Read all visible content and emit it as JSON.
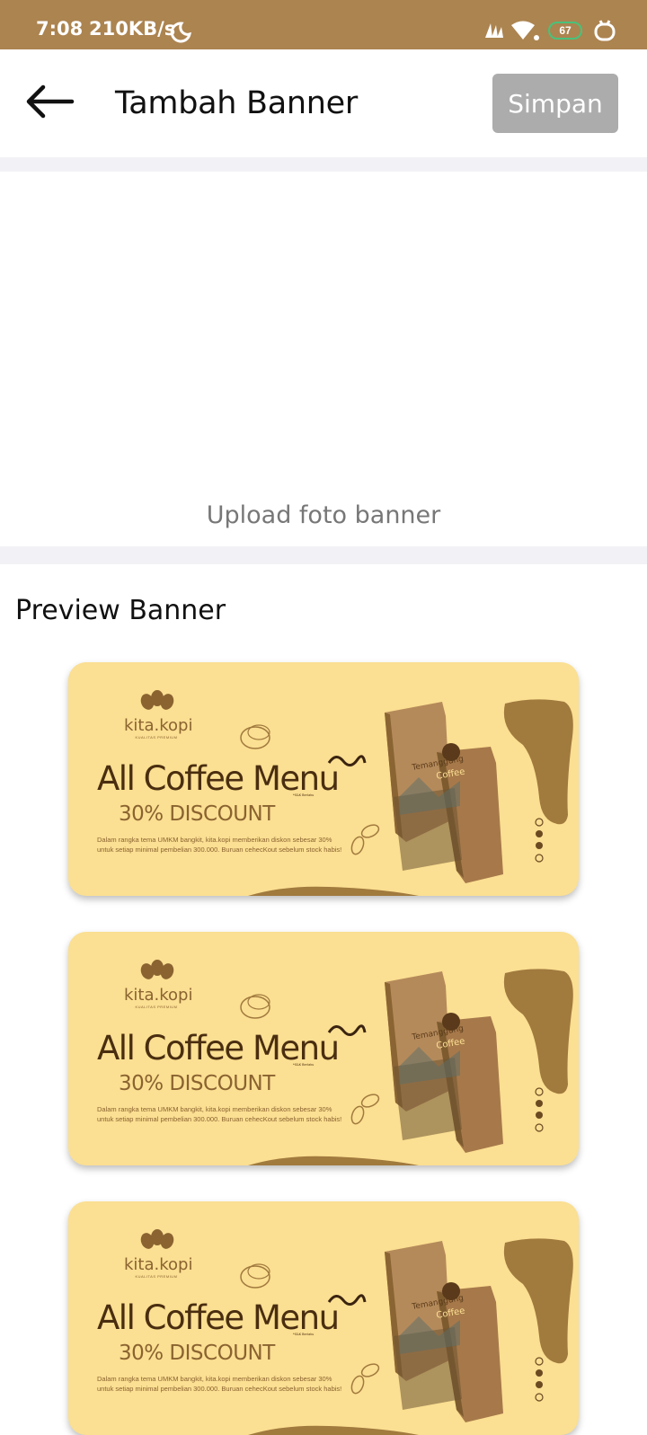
{
  "status_bar": {
    "time": "7:08",
    "net_speed": "210KB/s",
    "battery": "67"
  },
  "app_bar": {
    "title": "Tambah Banner",
    "save_label": "Simpan"
  },
  "upload": {
    "label": "Upload foto banner"
  },
  "preview": {
    "title": "Preview Banner",
    "banners": [
      {
        "logo": "kita.kopi",
        "logo_sub": "KUALITAS PREMIUM",
        "heading": "All Coffee Menu",
        "subheading": "30% DISCOUNT",
        "description": "Dalam rangka tema UMKM bangkit, kita.kopi memberikan diskon sebesar 30% untuk setiap minimal pembelian 300.000. Buruan cehecKout sebelum stock habis!",
        "package_text": "Temanggung Coffee"
      },
      {
        "logo": "kita.kopi",
        "logo_sub": "KUALITAS PREMIUM",
        "heading": "All Coffee Menu",
        "subheading": "30% DISCOUNT",
        "description": "Dalam rangka tema UMKM bangkit, kita.kopi memberikan diskon sebesar 30% untuk setiap minimal pembelian 300.000. Buruan cehecKout sebelum stock habis!",
        "package_text": "Temanggung Coffee"
      },
      {
        "logo": "kita.kopi",
        "logo_sub": "KUALITAS PREMIUM",
        "heading": "All Coffee Menu",
        "subheading": "30% DISCOUNT",
        "description": "Dalam rangka tema UMKM bangkit, kita.kopi memberikan diskon sebesar 30% untuk setiap minimal pembelian 300.000. Buruan cehecKout sebelum stock habis!",
        "package_text": "Temanggung Coffee"
      }
    ]
  },
  "colors": {
    "status_bar": "#ac8450",
    "save_disabled": "#acacac",
    "banner_bg": "#fbdf92",
    "banner_brown": "#a17a3e",
    "heading_text": "#4a2e10"
  },
  "icons": {
    "back": "arrow-left-icon",
    "upload": "image-upload-area",
    "social": [
      "instagram-icon",
      "facebook-icon",
      "twitter-icon",
      "whatsapp-icon"
    ]
  }
}
